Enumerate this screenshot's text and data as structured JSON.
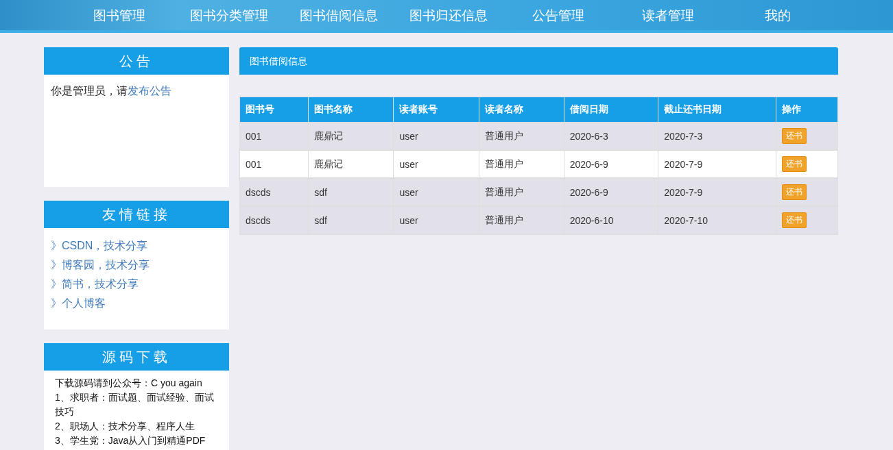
{
  "nav": {
    "items": [
      {
        "label": "图书管理"
      },
      {
        "label": "图书分类管理"
      },
      {
        "label": "图书借阅信息"
      },
      {
        "label": "图书归还信息"
      },
      {
        "label": "公告管理"
      },
      {
        "label": "读者管理"
      },
      {
        "label": "我的"
      }
    ]
  },
  "sidebar": {
    "notice": {
      "title": "公告",
      "text": "你是管理员，请",
      "link": "发布公告"
    },
    "links": {
      "title": "友情链接",
      "items": [
        {
          "mark": "》",
          "label": "CSDN，技术分享"
        },
        {
          "mark": "》",
          "label": "博客园，技术分享"
        },
        {
          "mark": "》",
          "label": "简书，技术分享"
        },
        {
          "mark": "》",
          "label": "个人博客"
        }
      ]
    },
    "download": {
      "title": "源码下载",
      "lines": [
        "下载源码请到公众号：C you again",
        "1、求职者：面试题、面试经验、面试技巧",
        "2、职场人：技术分享、程序人生",
        "3、学生党：Java从入门到精通PDF"
      ]
    }
  },
  "main": {
    "title": "图书借阅信息",
    "table": {
      "columns": [
        "图书号",
        "图书名称",
        "读者账号",
        "读者名称",
        "借阅日期",
        "截止还书日期",
        "操作"
      ],
      "rows": [
        {
          "cells": [
            "001",
            "鹿鼎记",
            "user",
            "普通用户",
            "2020-6-3",
            "2020-7-3"
          ],
          "action": "还书",
          "hovered": false
        },
        {
          "cells": [
            "001",
            "鹿鼎记",
            "user",
            "普通用户",
            "2020-6-9",
            "2020-7-9"
          ],
          "action": "还书",
          "hovered": true
        },
        {
          "cells": [
            "dscds",
            "sdf",
            "user",
            "普通用户",
            "2020-6-9",
            "2020-7-9"
          ],
          "action": "还书",
          "hovered": false
        },
        {
          "cells": [
            "dscds",
            "sdf",
            "user",
            "普通用户",
            "2020-6-10",
            "2020-7-10"
          ],
          "action": "还书",
          "hovered": false
        }
      ]
    }
  }
}
